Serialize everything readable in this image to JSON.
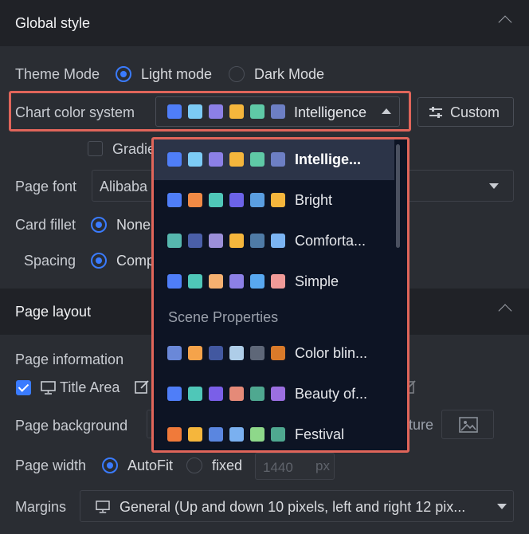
{
  "global_style": {
    "header": "Global style",
    "theme_mode": {
      "label": "Theme Mode",
      "options": [
        "Light mode",
        "Dark Mode"
      ],
      "selected": "Light mode"
    },
    "chart_color_system": {
      "label": "Chart color system",
      "selected_name": "Intelligence",
      "selected_swatches": [
        "#4f7ef8",
        "#7ccbf5",
        "#8c80e6",
        "#f5b63c",
        "#5fc9a6",
        "#6d7fc4"
      ],
      "custom_button": "Custom"
    },
    "gradient_label": "Gradie",
    "page_font": {
      "label": "Page font",
      "value": "Alibaba"
    },
    "card_fillet": {
      "label": "Card fillet",
      "value": "None"
    },
    "spacing": {
      "label": "Spacing",
      "value": "Comp"
    }
  },
  "page_layout": {
    "header": "Page layout",
    "page_information": "Page information",
    "title_area": "Title Area",
    "page_background": {
      "label": "Page background",
      "picture_label": "cture"
    },
    "page_width": {
      "label": "Page width",
      "options": [
        "AutoFit",
        "fixed"
      ],
      "selected": "AutoFit",
      "fixed_value": "1440",
      "unit": "px"
    },
    "margins": {
      "label": "Margins",
      "value": "General (Up and down 10 pixels, left and right 12 pix..."
    }
  },
  "color_dropdown": {
    "items": [
      {
        "name": "Intellige...",
        "selected": true,
        "swatches": [
          "#4f7ef8",
          "#7ccbf5",
          "#8c80e6",
          "#f5b63c",
          "#5fc9a6",
          "#6d7fc4"
        ]
      },
      {
        "name": "Bright",
        "selected": false,
        "swatches": [
          "#4f7ef8",
          "#f08a45",
          "#4fc7b8",
          "#6c63e8",
          "#5a9ee0",
          "#f5b63c"
        ]
      },
      {
        "name": "Comforta...",
        "selected": false,
        "swatches": [
          "#56b7ae",
          "#4a5fa8",
          "#9b8fd8",
          "#f5b63c",
          "#4f7ba6",
          "#7bb4f2"
        ]
      },
      {
        "name": "Simple",
        "selected": false,
        "swatches": [
          "#4f7ef8",
          "#4fc7b8",
          "#f5b070",
          "#8c80e6",
          "#58a8f0",
          "#f09a98"
        ]
      }
    ],
    "group_label": "Scene Properties",
    "scene_items": [
      {
        "name": "Color blin...",
        "swatches": [
          "#6a88d8",
          "#f5a34a",
          "#4258a0",
          "#aecde8",
          "#5e6778",
          "#d97a2a"
        ]
      },
      {
        "name": "Beauty of...",
        "swatches": [
          "#4f7ef8",
          "#4fc7b8",
          "#7a5fe8",
          "#e58a78",
          "#4fa890",
          "#9b6fe0"
        ]
      },
      {
        "name": "Festival",
        "swatches": [
          "#f07a3a",
          "#f5b63c",
          "#5a86e0",
          "#7ab0f0",
          "#8ed88a",
          "#4fa890"
        ]
      }
    ]
  }
}
